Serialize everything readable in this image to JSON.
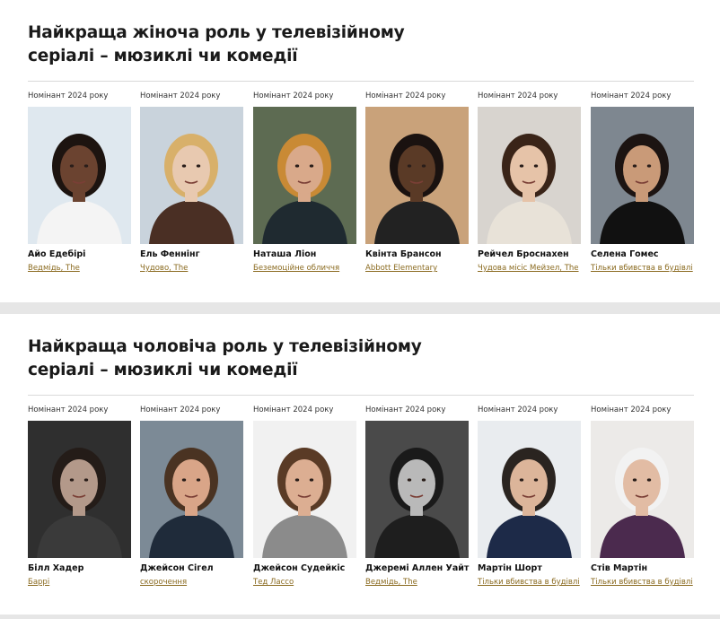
{
  "sections": [
    {
      "title": "Найкраща жіноча роль у телевізійному серіалі – мюзиклі чи комедії",
      "nominees": [
        {
          "year_label": "Номінант 2024 року",
          "name": "Айо Едебірі",
          "show": "Ведмідь, The",
          "bg": "#dfe8ef",
          "skin": "#6b4330",
          "hair": "#1d1410",
          "shirt": "#f4f4f4"
        },
        {
          "year_label": "Номінант 2024 року",
          "name": "Ель Феннінг",
          "show": "Чудово, The",
          "bg": "#c9d3dc",
          "skin": "#e8c9b0",
          "hair": "#d8b06a",
          "shirt": "#4a2f24"
        },
        {
          "year_label": "Номінант 2024 року",
          "name": "Наташа Ліон",
          "show": "Беземоційне обличчя",
          "bg": "#5d6b52",
          "skin": "#d9a98a",
          "hair": "#c98a35",
          "shirt": "#1f2a30"
        },
        {
          "year_label": "Номінант 2024 року",
          "name": "Квінта Брансон",
          "show": "Abbott Elementary",
          "bg": "#c9a27a",
          "skin": "#5a3a26",
          "hair": "#1a1210",
          "shirt": "#222222"
        },
        {
          "year_label": "Номінант 2024 року",
          "name": "Рейчел Броснахен",
          "show": "Чудова місіс Мейзел, The",
          "bg": "#d8d4cf",
          "skin": "#e6c3a8",
          "hair": "#3a2418",
          "shirt": "#e8e2d8"
        },
        {
          "year_label": "Номінант 2024 року",
          "name": "Селена Гомес",
          "show": "Тільки вбивства в будівлі",
          "bg": "#7e8790",
          "skin": "#c99a78",
          "hair": "#1c1412",
          "shirt": "#111111"
        }
      ]
    },
    {
      "title": "Найкраща чоловіча роль у телевізійному серіалі – мюзиклі чи комедії",
      "nominees": [
        {
          "year_label": "Номінант 2024 року",
          "name": "Білл Хадер",
          "show": "Баррі",
          "bg": "#2f2f2f",
          "skin": "#b3998a",
          "hair": "#241c18",
          "shirt": "#3a3a3a"
        },
        {
          "year_label": "Номінант 2024 року",
          "name": "Джейсон Сігел",
          "show": "скорочення",
          "bg": "#7c8a96",
          "skin": "#d9a588",
          "hair": "#4a3322",
          "shirt": "#1f2b3a"
        },
        {
          "year_label": "Номінант 2024 року",
          "name": "Джейсон Судейкіс",
          "show": "Тед Лассо",
          "bg": "#f1f1f1",
          "skin": "#dcae92",
          "hair": "#5a3b26",
          "shirt": "#8b8b8b"
        },
        {
          "year_label": "Номінант 2024 року",
          "name": "Джеремі Аллен Уайт",
          "show": "Ведмідь, The",
          "bg": "#4a4a4a",
          "skin": "#b9b9b9",
          "hair": "#1a1a1a",
          "shirt": "#1e1e1e"
        },
        {
          "year_label": "Номінант 2024 року",
          "name": "Мартін Шорт",
          "show": "Тільки вбивства в будівлі",
          "bg": "#e9ecef",
          "skin": "#dcb59a",
          "hair": "#2a2420",
          "shirt": "#1d2a48"
        },
        {
          "year_label": "Номінант 2024 року",
          "name": "Стів Мартін",
          "show": "Тільки вбивства в будівлі",
          "bg": "#eceae8",
          "skin": "#e2bca4",
          "hair": "#f2f2f2",
          "shirt": "#4b2a4e"
        }
      ]
    }
  ]
}
